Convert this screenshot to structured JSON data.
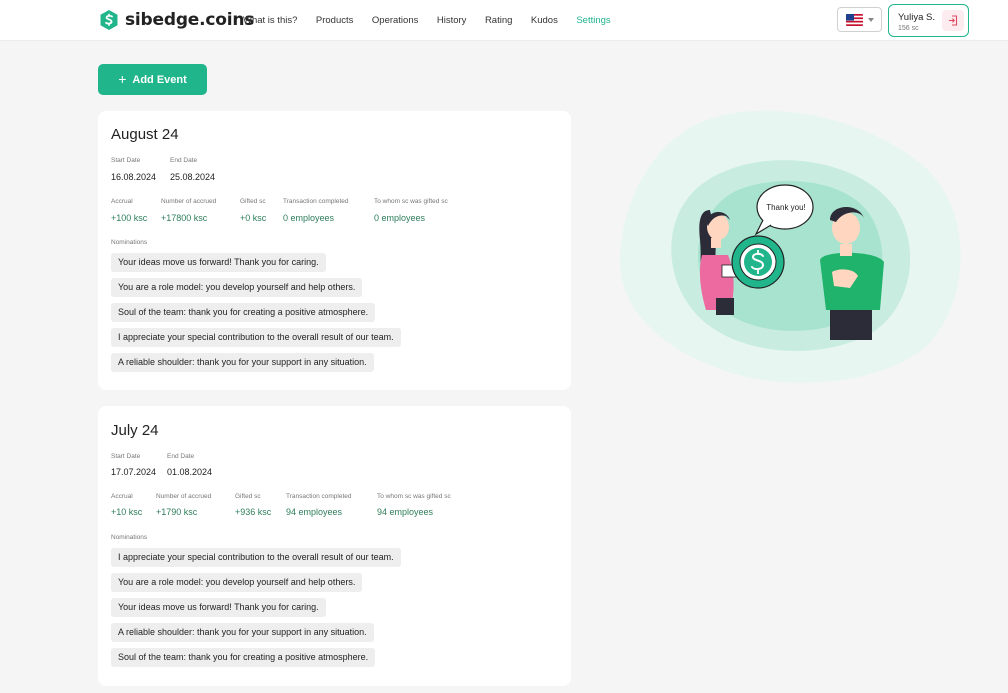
{
  "brand": {
    "name": "sibedge.coins",
    "accent": "#21b58c"
  },
  "nav": [
    {
      "label": "What is this?",
      "active": false
    },
    {
      "label": "Products",
      "active": false
    },
    {
      "label": "Operations",
      "active": false
    },
    {
      "label": "History",
      "active": false
    },
    {
      "label": "Rating",
      "active": false
    },
    {
      "label": "Kudos",
      "active": false
    },
    {
      "label": "Settings",
      "active": true
    }
  ],
  "language": {
    "flag_icon": "us-flag-icon"
  },
  "user": {
    "name": "Yuliya S.",
    "coins": "156 sc"
  },
  "add_event_label": "Add Event",
  "illustration": {
    "speech": "Thank you!"
  },
  "labels": {
    "start_date": "Start Date",
    "end_date": "End Date",
    "accrual": "Accrual",
    "number_accrued": "Number of accrued",
    "gifted": "Gifted sc",
    "transaction_completed": "Transaction completed",
    "to_whom": "To whom sc was gifted sc",
    "nominations": "Nominations"
  },
  "events": [
    {
      "title": "August 24",
      "start_date": "16.08.2024",
      "end_date": "25.08.2024",
      "accrual": "+100 ksc",
      "number_accrued": "+17800 ksc",
      "gifted": "+0 ksc",
      "transaction_completed": "0 employees",
      "to_whom": "0 employees",
      "nominations": [
        "Your ideas move us forward! Thank you for caring.",
        "You are a role model: you develop yourself and help others.",
        "Soul of the team: thank you for creating a positive atmosphere.",
        "I appreciate your special contribution to the overall result of our team.",
        "A reliable shoulder: thank you for your support in any situation."
      ]
    },
    {
      "title": "July 24",
      "start_date": "17.07.2024",
      "end_date": "01.08.2024",
      "accrual": "+10 ksc",
      "number_accrued": "+1790 ksc",
      "gifted": "+936 ksc",
      "transaction_completed": "94 employees",
      "to_whom": "94 employees",
      "nominations": [
        "I appreciate your special contribution to the overall result of our team.",
        "You are a role model: you develop yourself and help others.",
        "Your ideas move us forward! Thank you for caring.",
        "A reliable shoulder: thank you for your support in any situation.",
        "Soul of the team: thank you for creating a positive atmosphere."
      ]
    }
  ]
}
